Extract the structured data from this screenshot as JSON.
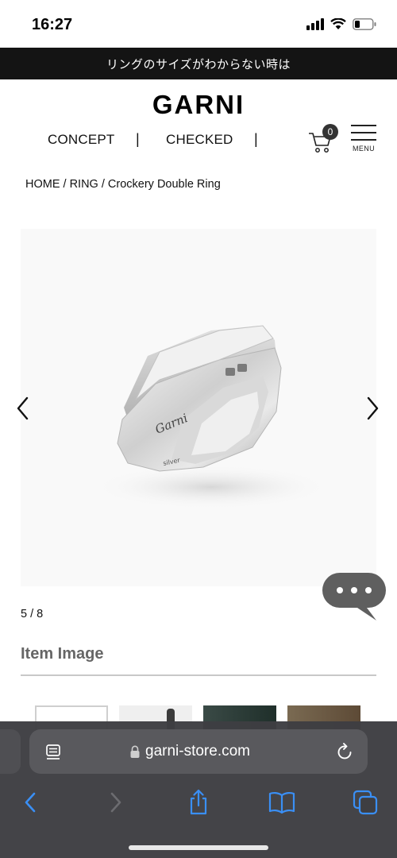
{
  "status_bar": {
    "time": "16:27"
  },
  "announcement": "リングのサイズがわからない時は",
  "header": {
    "logo": "GARNI",
    "nav": [
      {
        "label": "CONCEPT"
      },
      {
        "label": "CHECKED"
      }
    ],
    "nav_separator": "|",
    "cart_count": "0",
    "menu_label": "MENU"
  },
  "breadcrumb": "HOME / RING / Crockery Double Ring",
  "gallery": {
    "counter": "5 / 8",
    "engravings": {
      "brand": "Garni",
      "metal": "silver"
    }
  },
  "item_image": {
    "title": "Item Image"
  },
  "browser": {
    "url": "garni-store.com"
  },
  "colors": {
    "announce_bg": "#141414",
    "toolbar_bg": "#3e3e42",
    "toolbar_icon": "#3a8ff5",
    "chat_bubble": "#5f5f5f"
  }
}
